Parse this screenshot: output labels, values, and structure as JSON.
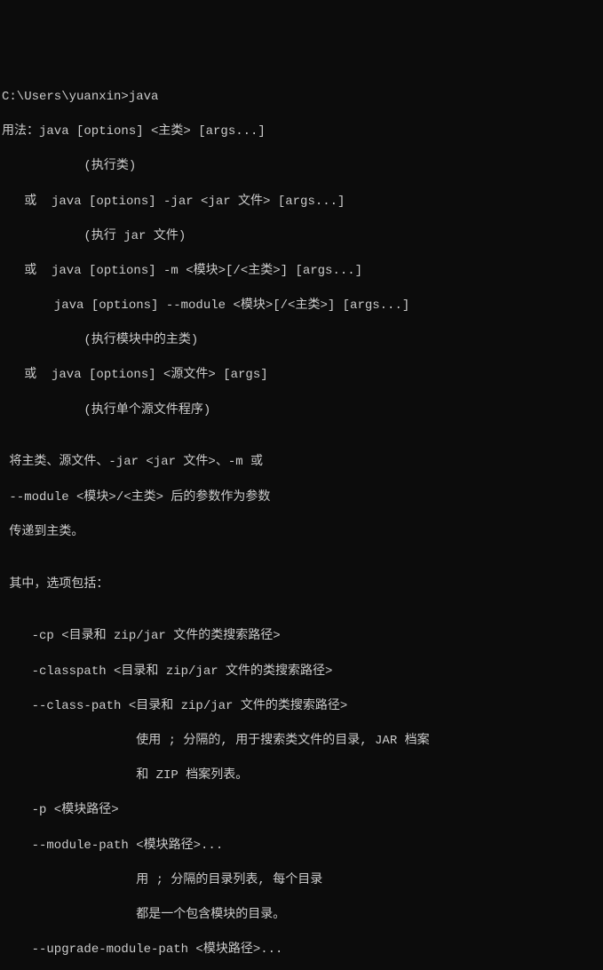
{
  "terminal": {
    "lines": [
      "C:\\Users\\yuanxin>java",
      "用法：java [options] <主类> [args...]",
      "           (执行类)",
      "   或  java [options] -jar <jar 文件> [args...]",
      "           (执行 jar 文件)",
      "   或  java [options] -m <模块>[/<主类>] [args...]",
      "       java [options] --module <模块>[/<主类>] [args...]",
      "           (执行模块中的主类)",
      "   或  java [options] <源文件> [args]",
      "           (执行单个源文件程序)",
      "",
      " 将主类、源文件、-jar <jar 文件>、-m 或",
      " --module <模块>/<主类> 后的参数作为参数",
      " 传递到主类。",
      "",
      " 其中，选项包括：",
      "",
      "    -cp <目录和 zip/jar 文件的类搜索路径>",
      "    -classpath <目录和 zip/jar 文件的类搜索路径>",
      "    --class-path <目录和 zip/jar 文件的类搜索路径>",
      "                  使用 ; 分隔的, 用于搜索类文件的目录, JAR 档案",
      "                  和 ZIP 档案列表。",
      "    -p <模块路径>",
      "    --module-path <模块路径>...",
      "                  用 ; 分隔的目录列表, 每个目录",
      "                  都是一个包含模块的目录。",
      "    --upgrade-module-path <模块路径>..."
    ]
  }
}
